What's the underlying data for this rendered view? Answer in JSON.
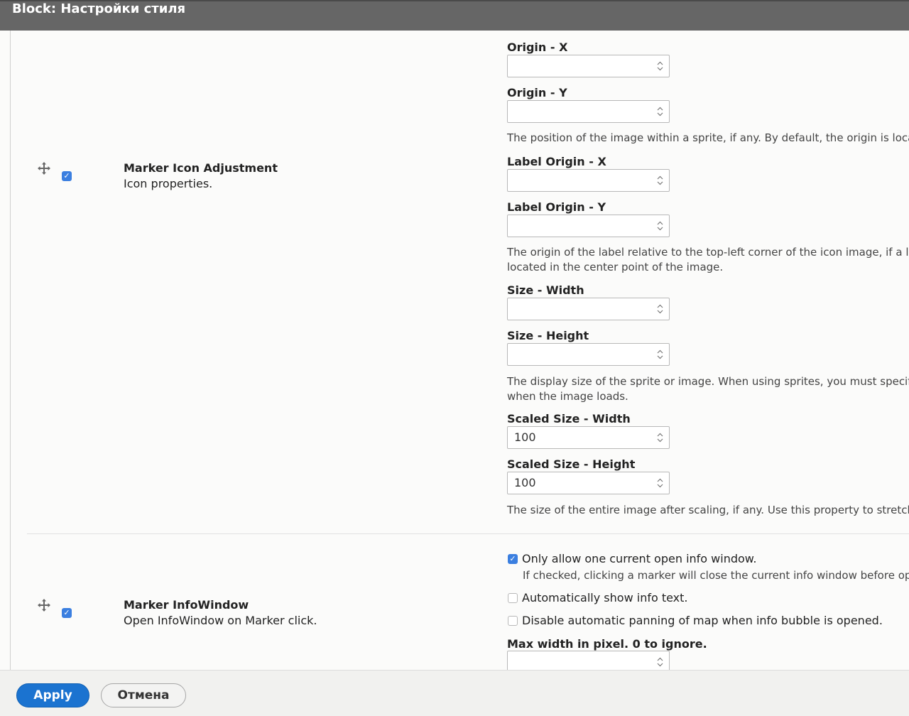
{
  "dialog": {
    "title": "Block: Настройки стиля"
  },
  "rows": [
    {
      "title": "Marker Icon Adjustment",
      "description": "Icon properties.",
      "enabled": true,
      "fields": [
        {
          "label": "Origin - X",
          "value": ""
        },
        {
          "label": "Origin - Y",
          "value": ""
        },
        {
          "label": "Label Origin - X",
          "value": ""
        },
        {
          "label": "Label Origin - Y",
          "value": ""
        },
        {
          "label": "Size - Width",
          "value": ""
        },
        {
          "label": "Size - Height",
          "value": ""
        },
        {
          "label": "Scaled Size - Width",
          "value": "100"
        },
        {
          "label": "Scaled Size - Height",
          "value": "100"
        }
      ],
      "help": {
        "origin": "The position of the image within a sprite, if any. By default, the origin is locate",
        "label_origin_1": "The origin of the label relative to the top-left corner of the icon image, if a labe",
        "label_origin_2": "located in the center point of the image.",
        "size_1": "The display size of the sprite or image. When using sprites, you must specify t",
        "size_2": "when the image loads.",
        "scaled": "The size of the entire image after scaling, if any. Use this property to stretch/s"
      }
    },
    {
      "title": "Marker InfoWindow",
      "description": "Open InfoWindow on Marker click.",
      "enabled": true,
      "options": [
        {
          "label": "Only allow one current open info window.",
          "checked": true
        },
        {
          "label": "Automatically show info text.",
          "checked": false
        },
        {
          "label": "Disable automatic panning of map when info bubble is opened.",
          "checked": false
        }
      ],
      "option_help": "If checked, clicking a marker will close the current info window before open",
      "max_width_label": "Max width in pixel. 0 to ignore.",
      "max_width_value": ""
    }
  ],
  "footer": {
    "apply_label": "Apply",
    "cancel_label": "Отмена"
  },
  "colors": {
    "titlebar": "#666666",
    "accent": "#1b73d0",
    "checkbox": "#3b7fe0"
  }
}
